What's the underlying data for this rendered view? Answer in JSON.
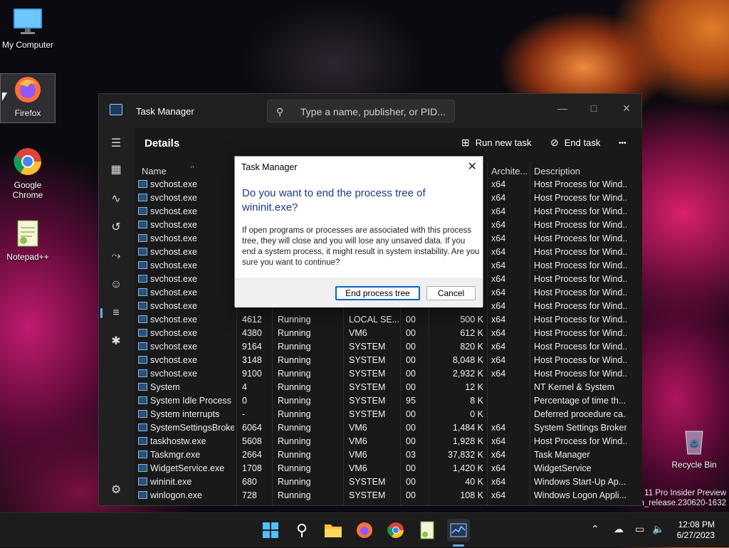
{
  "desktop": {
    "icons": [
      {
        "label": "My Computer"
      },
      {
        "label": "Firefox"
      },
      {
        "label": "Google Chrome"
      },
      {
        "label": "Notepad++"
      },
      {
        "label": "Recycle Bin"
      }
    ],
    "watermark_line1": "11 Pro Insider Preview",
    "watermark_line2": "n_release.230620-1632"
  },
  "window": {
    "title": "Task Manager",
    "search_placeholder": "Type a name, publisher, or PID...",
    "page_title": "Details",
    "run_new_task": "Run new task",
    "end_task": "End task",
    "more": "•••"
  },
  "table": {
    "headers": {
      "name": "Name",
      "architecture": "Archite...",
      "description": "Description"
    },
    "rows": [
      {
        "name": "svchost.exe",
        "pid": "",
        "status": "",
        "user": "",
        "cpu": "",
        "mem": "",
        "arch": "x64",
        "desc": "Host Process for Wind..."
      },
      {
        "name": "svchost.exe",
        "pid": "",
        "status": "",
        "user": "",
        "cpu": "",
        "mem": "",
        "arch": "x64",
        "desc": "Host Process for Wind..."
      },
      {
        "name": "svchost.exe",
        "pid": "",
        "status": "",
        "user": "",
        "cpu": "",
        "mem": "",
        "arch": "x64",
        "desc": "Host Process for Wind..."
      },
      {
        "name": "svchost.exe",
        "pid": "",
        "status": "",
        "user": "",
        "cpu": "",
        "mem": "",
        "arch": "x64",
        "desc": "Host Process for Wind..."
      },
      {
        "name": "svchost.exe",
        "pid": "",
        "status": "",
        "user": "",
        "cpu": "",
        "mem": "",
        "arch": "x64",
        "desc": "Host Process for Wind..."
      },
      {
        "name": "svchost.exe",
        "pid": "",
        "status": "",
        "user": "",
        "cpu": "",
        "mem": "",
        "arch": "x64",
        "desc": "Host Process for Wind..."
      },
      {
        "name": "svchost.exe",
        "pid": "",
        "status": "",
        "user": "",
        "cpu": "",
        "mem": "",
        "arch": "x64",
        "desc": "Host Process for Wind..."
      },
      {
        "name": "svchost.exe",
        "pid": "",
        "status": "",
        "user": "",
        "cpu": "",
        "mem": "",
        "arch": "x64",
        "desc": "Host Process for Wind..."
      },
      {
        "name": "svchost.exe",
        "pid": "",
        "status": "",
        "user": "",
        "cpu": "",
        "mem": "",
        "arch": "x64",
        "desc": "Host Process for Wind..."
      },
      {
        "name": "svchost.exe",
        "pid": "",
        "status": "",
        "user": "",
        "cpu": "",
        "mem": "",
        "arch": "x64",
        "desc": "Host Process for Wind..."
      },
      {
        "name": "svchost.exe",
        "pid": "4612",
        "status": "Running",
        "user": "LOCAL SE...",
        "cpu": "00",
        "mem": "500 K",
        "arch": "x64",
        "desc": "Host Process for Wind..."
      },
      {
        "name": "svchost.exe",
        "pid": "4380",
        "status": "Running",
        "user": "VM6",
        "cpu": "00",
        "mem": "612 K",
        "arch": "x64",
        "desc": "Host Process for Wind..."
      },
      {
        "name": "svchost.exe",
        "pid": "9164",
        "status": "Running",
        "user": "SYSTEM",
        "cpu": "00",
        "mem": "820 K",
        "arch": "x64",
        "desc": "Host Process for Wind..."
      },
      {
        "name": "svchost.exe",
        "pid": "3148",
        "status": "Running",
        "user": "SYSTEM",
        "cpu": "00",
        "mem": "8,048 K",
        "arch": "x64",
        "desc": "Host Process for Wind..."
      },
      {
        "name": "svchost.exe",
        "pid": "9100",
        "status": "Running",
        "user": "SYSTEM",
        "cpu": "00",
        "mem": "2,932 K",
        "arch": "x64",
        "desc": "Host Process for Wind..."
      },
      {
        "name": "System",
        "pid": "4",
        "status": "Running",
        "user": "SYSTEM",
        "cpu": "00",
        "mem": "12 K",
        "arch": "",
        "desc": "NT Kernel & System"
      },
      {
        "name": "System Idle Process",
        "pid": "0",
        "status": "Running",
        "user": "SYSTEM",
        "cpu": "95",
        "mem": "8 K",
        "arch": "",
        "desc": "Percentage of time th..."
      },
      {
        "name": "System interrupts",
        "pid": "-",
        "status": "Running",
        "user": "SYSTEM",
        "cpu": "00",
        "mem": "0 K",
        "arch": "",
        "desc": "Deferred procedure ca..."
      },
      {
        "name": "SystemSettingsBroke...",
        "pid": "6064",
        "status": "Running",
        "user": "VM6",
        "cpu": "00",
        "mem": "1,484 K",
        "arch": "x64",
        "desc": "System Settings Broker"
      },
      {
        "name": "taskhostw.exe",
        "pid": "5608",
        "status": "Running",
        "user": "VM6",
        "cpu": "00",
        "mem": "1,928 K",
        "arch": "x64",
        "desc": "Host Process for Wind..."
      },
      {
        "name": "Taskmgr.exe",
        "pid": "2664",
        "status": "Running",
        "user": "VM6",
        "cpu": "03",
        "mem": "37,832 K",
        "arch": "x64",
        "desc": "Task Manager"
      },
      {
        "name": "WidgetService.exe",
        "pid": "1708",
        "status": "Running",
        "user": "VM6",
        "cpu": "00",
        "mem": "1,420 K",
        "arch": "x64",
        "desc": "WidgetService"
      },
      {
        "name": "wininit.exe",
        "pid": "680",
        "status": "Running",
        "user": "SYSTEM",
        "cpu": "00",
        "mem": "40 K",
        "arch": "x64",
        "desc": "Windows Start-Up Ap..."
      },
      {
        "name": "winlogon.exe",
        "pid": "728",
        "status": "Running",
        "user": "SYSTEM",
        "cpu": "00",
        "mem": "108 K",
        "arch": "x64",
        "desc": "Windows Logon Appli..."
      }
    ]
  },
  "dialog": {
    "title": "Task Manager",
    "heading": "Do you want to end the process tree of wininit.exe?",
    "body": "If open programs or processes are associated with this process tree, they will close and you will lose any unsaved data. If you end a system process, it might result in system instability. Are you sure you want to continue?",
    "primary": "End process tree",
    "cancel": "Cancel"
  },
  "taskbar": {
    "time": "12:08 PM",
    "date": "6/27/2023"
  }
}
